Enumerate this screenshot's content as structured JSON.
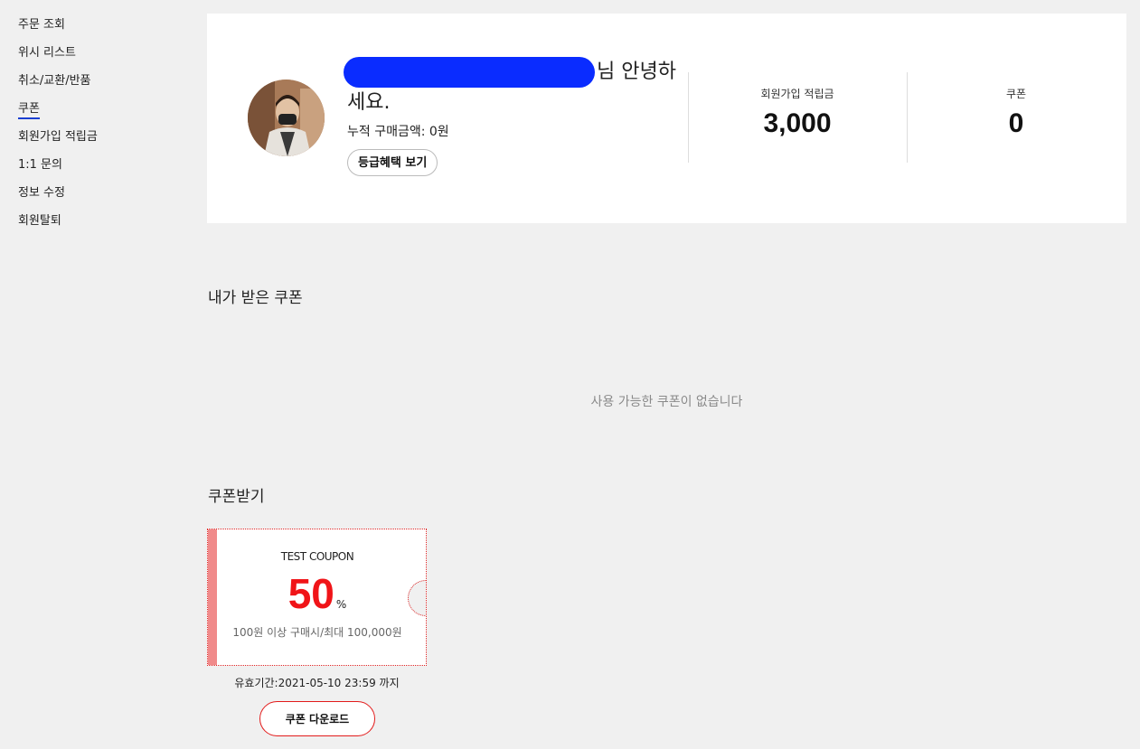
{
  "sidebar": {
    "items": [
      {
        "label": "주문 조회"
      },
      {
        "label": "위시 리스트"
      },
      {
        "label": "취소/교환/반품"
      },
      {
        "label": "쿠폰",
        "active": true
      },
      {
        "label": "회원가입 적립금"
      },
      {
        "label": "1:1 문의"
      },
      {
        "label": "정보 수정"
      },
      {
        "label": "회원탈퇴"
      }
    ]
  },
  "profile": {
    "greeting_suffix": "님 안녕하세요.",
    "accumulated": "누적 구매금액: 0원",
    "grade_button": "등급혜택 보기",
    "redaction_color": "#0a2cff"
  },
  "stats": {
    "points_label": "회원가입 적립금",
    "points_value": "3,000",
    "coupon_label": "쿠폰",
    "coupon_value": "0"
  },
  "my_coupons": {
    "title": "내가 받은 쿠폰",
    "empty_message": "사용 가능한 쿠폰이 없습니다"
  },
  "receive_coupons": {
    "title": "쿠폰받기",
    "coupon": {
      "name": "TEST COUPON",
      "amount": "50",
      "unit": "%",
      "condition": "100원 이상 구매시/최대 100,000원",
      "expiry": "유효기간:2021-05-10 23:59 까지",
      "download_label": "쿠폰 다운로드",
      "accent_color": "#f01418"
    }
  }
}
